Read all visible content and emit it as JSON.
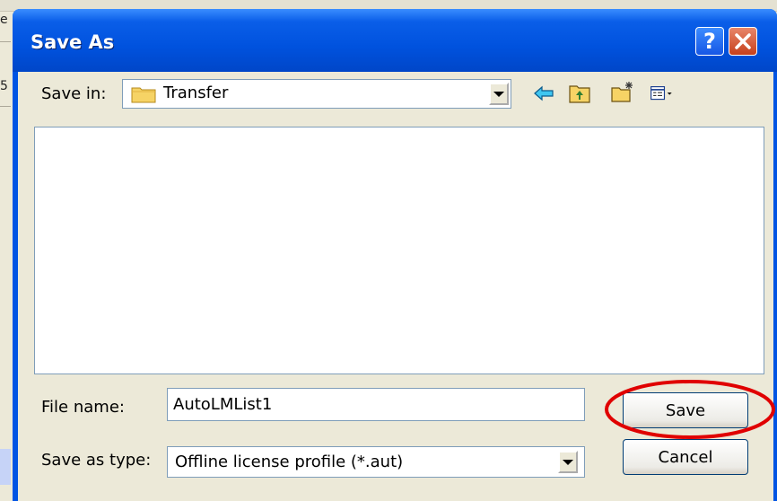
{
  "background": {
    "frag1": "e",
    "frag2": "5"
  },
  "dialog": {
    "title": "Save As",
    "help_label": "?",
    "close_label": "✕",
    "save_in": {
      "label": "Save in:",
      "value": "Transfer"
    },
    "toolbar": {
      "icons": [
        "back-icon",
        "up-one-level-icon",
        "new-folder-icon",
        "views-menu-icon"
      ]
    },
    "file_name": {
      "label": "File name:",
      "value": "AutoLMList1"
    },
    "save_as_type": {
      "label": "Save as type:",
      "value": "Offline license profile (*.aut)"
    },
    "buttons": {
      "save": "Save",
      "cancel": "Cancel"
    },
    "colors": {
      "title_bar": "#0054E3",
      "highlight": "#E00000"
    }
  }
}
